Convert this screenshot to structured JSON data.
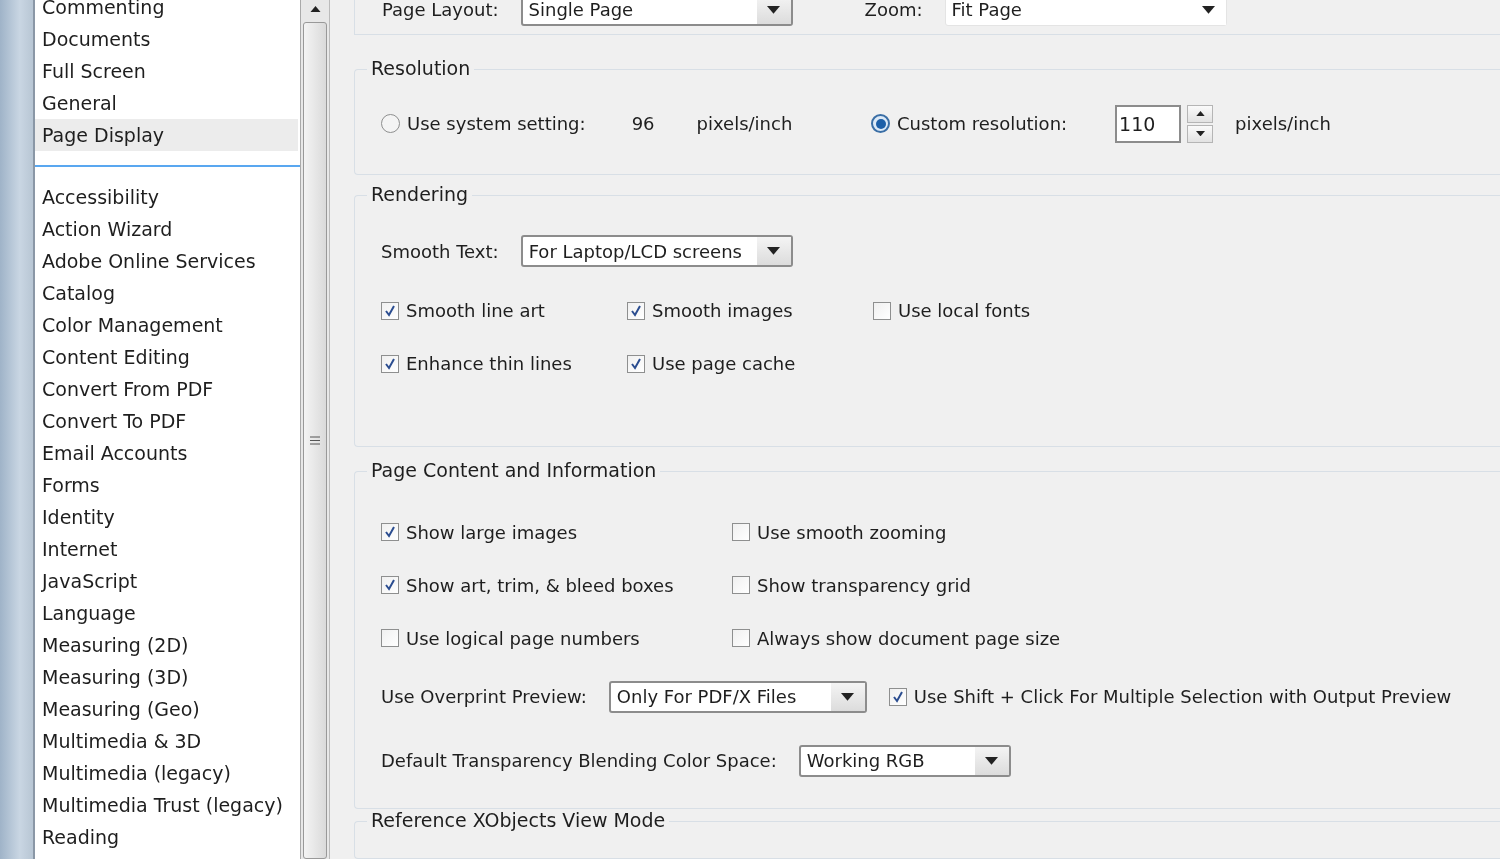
{
  "sidebar": {
    "groups": [
      {
        "items": [
          {
            "label": "Commenting",
            "selected": false
          },
          {
            "label": "Documents",
            "selected": false
          },
          {
            "label": "Full Screen",
            "selected": false
          },
          {
            "label": "General",
            "selected": false
          },
          {
            "label": "Page Display",
            "selected": true
          }
        ]
      },
      {
        "items": [
          {
            "label": "Accessibility",
            "selected": false
          },
          {
            "label": "Action Wizard",
            "selected": false
          },
          {
            "label": "Adobe Online Services",
            "selected": false
          },
          {
            "label": "Catalog",
            "selected": false
          },
          {
            "label": "Color Management",
            "selected": false
          },
          {
            "label": "Content Editing",
            "selected": false
          },
          {
            "label": "Convert From PDF",
            "selected": false
          },
          {
            "label": "Convert To PDF",
            "selected": false
          },
          {
            "label": "Email Accounts",
            "selected": false
          },
          {
            "label": "Forms",
            "selected": false
          },
          {
            "label": "Identity",
            "selected": false
          },
          {
            "label": "Internet",
            "selected": false
          },
          {
            "label": "JavaScript",
            "selected": false
          },
          {
            "label": "Language",
            "selected": false
          },
          {
            "label": "Measuring (2D)",
            "selected": false
          },
          {
            "label": "Measuring (3D)",
            "selected": false
          },
          {
            "label": "Measuring (Geo)",
            "selected": false
          },
          {
            "label": "Multimedia & 3D",
            "selected": false
          },
          {
            "label": "Multimedia (legacy)",
            "selected": false
          },
          {
            "label": "Multimedia Trust (legacy)",
            "selected": false
          },
          {
            "label": "Reading",
            "selected": false
          }
        ]
      }
    ]
  },
  "layout_row": [
    {
      "label": "Page Layout:",
      "value": "Single Page",
      "kind": "framed"
    },
    {
      "label": "Zoom:",
      "value": "Fit Page",
      "kind": "flat"
    }
  ],
  "resolution": {
    "title": "Resolution",
    "options": [
      {
        "kind": "static",
        "label": "Use system setting:",
        "selected": false,
        "value": "96",
        "unit": "pixels/inch"
      },
      {
        "kind": "field",
        "label": "Custom resolution:",
        "selected": true,
        "value": "110",
        "unit": "pixels/inch"
      }
    ]
  },
  "rendering": {
    "title": "Rendering",
    "smooth_text": {
      "label": "Smooth Text:",
      "value": "For Laptop/LCD screens"
    },
    "checkbox_rows": [
      [
        {
          "label": "Smooth line art",
          "checked": true
        },
        {
          "label": "Smooth images",
          "checked": true
        },
        {
          "label": "Use local fonts",
          "checked": false
        }
      ],
      [
        {
          "label": "Enhance thin lines",
          "checked": true
        },
        {
          "label": "Use page cache",
          "checked": true
        }
      ]
    ]
  },
  "page_content": {
    "title": "Page Content and Information",
    "checkbox_rows": [
      [
        {
          "label": "Show large images",
          "checked": true
        },
        {
          "label": "Use smooth zooming",
          "checked": false
        }
      ],
      [
        {
          "label": "Show art, trim, & bleed boxes",
          "checked": true
        },
        {
          "label": "Show transparency grid",
          "checked": false
        }
      ],
      [
        {
          "label": "Use logical page numbers",
          "checked": false
        },
        {
          "label": "Always show document page size",
          "checked": false
        }
      ]
    ],
    "overprint": {
      "label": "Use Overprint Preview:",
      "value": "Only For PDF/X Files"
    },
    "shift_click": {
      "label": "Use Shift + Click For Multiple Selection with Output Preview",
      "checked": true
    },
    "blending": {
      "label": "Default Transparency Blending Color Space:",
      "value": "Working RGB"
    }
  },
  "reference": {
    "title": "Reference XObjects View Mode"
  }
}
